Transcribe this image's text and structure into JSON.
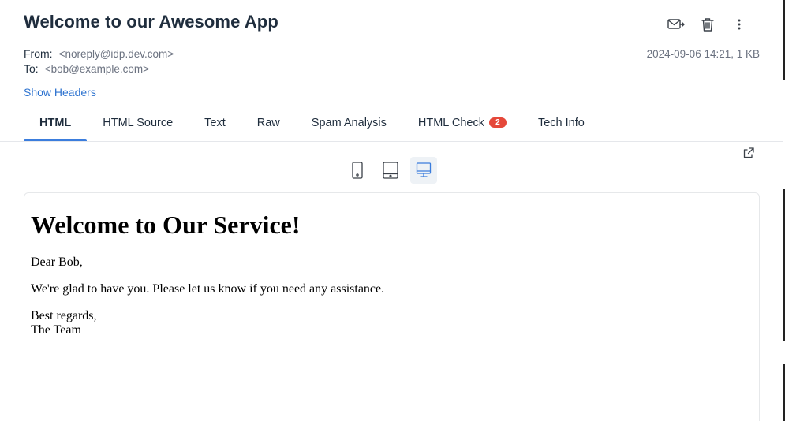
{
  "email": {
    "subject": "Welcome to our Awesome App",
    "from_label": "From:",
    "from_value": "<noreply@idp.dev.com>",
    "to_label": "To:",
    "to_value": "<bob@example.com>",
    "date_size": "2024-09-06 14:21, 1 KB",
    "show_headers": "Show Headers"
  },
  "actions": [
    {
      "icon": "mail-forward-icon"
    },
    {
      "icon": "trash-icon"
    },
    {
      "icon": "more-vertical-icon"
    }
  ],
  "tabs": [
    {
      "label": "HTML",
      "active": true
    },
    {
      "label": "HTML Source"
    },
    {
      "label": "Text"
    },
    {
      "label": "Raw"
    },
    {
      "label": "Spam Analysis"
    },
    {
      "label": "HTML Check",
      "badge": "2"
    },
    {
      "label": "Tech Info"
    }
  ],
  "device_toggle": {
    "options": [
      "phone-icon",
      "tablet-icon",
      "desktop-icon"
    ],
    "selected": "desktop-icon"
  },
  "preview": {
    "heading": "Welcome to Our Service!",
    "greeting": "Dear Bob,",
    "body": "We're glad to have you. Please let us know if you need any assistance.",
    "closing_line1": "Best regards,",
    "closing_line2": "The Team"
  },
  "colors": {
    "accent": "#3b7ddd",
    "link": "#2f74d0",
    "badge": "#e5483a",
    "text": "#1f2d3d",
    "muted": "#6b7280"
  }
}
